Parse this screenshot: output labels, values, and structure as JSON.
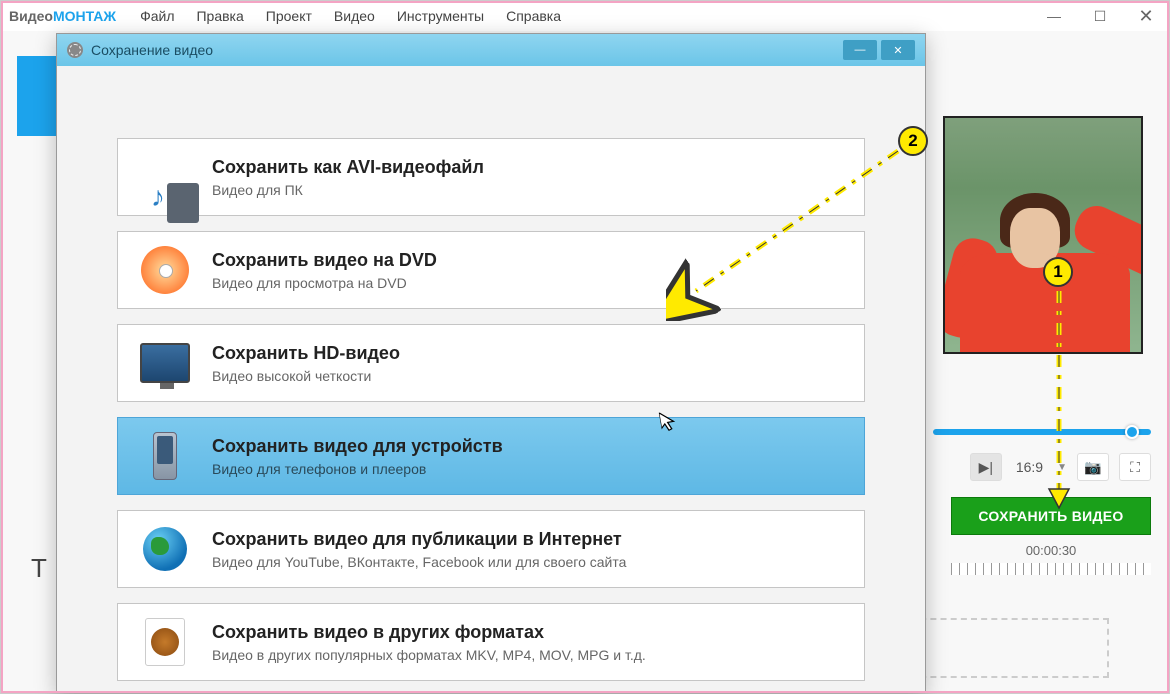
{
  "app": {
    "name_part1": "Видео",
    "name_part2": "МОНТАЖ"
  },
  "menu": [
    "Файл",
    "Правка",
    "Проект",
    "Видео",
    "Инструменты",
    "Справка"
  ],
  "dialog": {
    "title": "Сохранение видео",
    "options": [
      {
        "title": "Сохранить как AVI-видеофайл",
        "sub": "Видео для ПК"
      },
      {
        "title": "Сохранить видео на DVD",
        "sub": "Видео для просмотра на DVD"
      },
      {
        "title": "Сохранить HD-видео",
        "sub": "Видео высокой четкости"
      },
      {
        "title": "Сохранить видео для устройств",
        "sub": "Видео для телефонов и плееров"
      },
      {
        "title": "Сохранить видео для публикации в Интернет",
        "sub": "Видео для YouTube, ВКонтакте, Facebook или для своего сайта"
      },
      {
        "title": "Сохранить видео в других форматах",
        "sub": "Видео в других популярных форматах MKV, MP4, MOV, MPG и т.д."
      }
    ]
  },
  "player": {
    "ratio": "16:9",
    "timestamp": "00:00:30"
  },
  "save_button": "СОХРАНИТЬ ВИДЕО",
  "annotations": {
    "marker1": "1",
    "marker2": "2"
  },
  "timeline": {
    "label": "Т"
  }
}
